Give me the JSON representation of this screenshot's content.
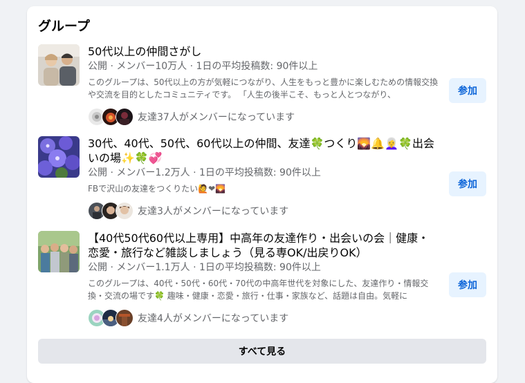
{
  "section": {
    "title": "グループ"
  },
  "groups": [
    {
      "name": "50代以上の仲間さがし",
      "meta": "公開 · メンバー10万人 · 1日の平均投稿数: 90件以上",
      "description": "このグループは、50代以上の方が気軽につながり、人生をもっと豊かに楽しむための情報交換や交流を目的としたコミュニティです。 「人生の後半こそ、もっと人とつながり、",
      "friends_text": "友達37人がメンバーになっています",
      "join_label": "参加"
    },
    {
      "name": "30代、40代、50代、60代以上の仲間、友達🍀つくり🌄🔔👩‍🦳🍀出会いの場✨🍀💞",
      "meta": "公開 · メンバー1.2万人 · 1日の平均投稿数: 90件以上",
      "description": "FBで沢山の友達をつくりたい🙋❤🌄",
      "friends_text": "友達3人がメンバーになっています",
      "join_label": "参加"
    },
    {
      "name": "【40代50代60代以上専用】中高年の友達作り・出会いの会｜健康・恋愛・旅行など雑談しましょう（見る専OK/出戻りOK）",
      "meta": "公開 · メンバー1.1万人 · 1日の平均投稿数: 90件以上",
      "description": "このグループは、40代・50代・60代・70代の中高年世代を対象にした、友達作り・情報交換・交流の場です🍀 趣味・健康・恋愛・旅行・仕事・家族など、話題は自由。気軽に",
      "friends_text": "友達4人がメンバーになっています",
      "join_label": "参加"
    }
  ],
  "see_all_label": "すべて見る",
  "colors": {
    "card_bg": "#ffffff",
    "page_bg": "#f0f2f5",
    "join_bg": "#e7f3ff",
    "join_text": "#0b64d8",
    "secondary_text": "#65676b",
    "see_all_bg": "#e4e6eb"
  }
}
